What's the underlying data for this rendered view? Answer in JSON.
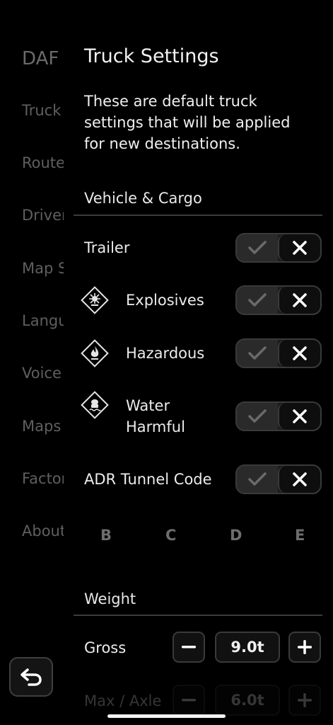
{
  "sidebar": {
    "brand": "DAF",
    "items": [
      {
        "label": "Truck Settings"
      },
      {
        "label": "Route Options"
      },
      {
        "label": "Driver Options"
      },
      {
        "label": "Map Settings"
      },
      {
        "label": "Language"
      },
      {
        "label": "Voice"
      },
      {
        "label": "Maps"
      },
      {
        "label": "Factory Reset"
      },
      {
        "label": "About"
      }
    ]
  },
  "main": {
    "title": "Truck Settings",
    "description": "These are default truck settings that will be applied for new destinations.",
    "vehicle_section": "Vehicle & Cargo",
    "rows": {
      "trailer": "Trailer",
      "explosives": "Explosives",
      "hazardous": "Hazardous",
      "water_harmful_line1": "Water",
      "water_harmful_line2": "Harmful",
      "adr": "ADR Tunnel Code"
    },
    "tunnel_codes": [
      "B",
      "C",
      "D",
      "E"
    ],
    "weight_section": "Weight",
    "gross": {
      "label": "Gross",
      "value": "9.0t"
    },
    "max_axle": {
      "label": "Max / Axle",
      "value": "6.0t"
    }
  },
  "colors": {
    "accent": "#f5c400",
    "background": "#000000"
  }
}
